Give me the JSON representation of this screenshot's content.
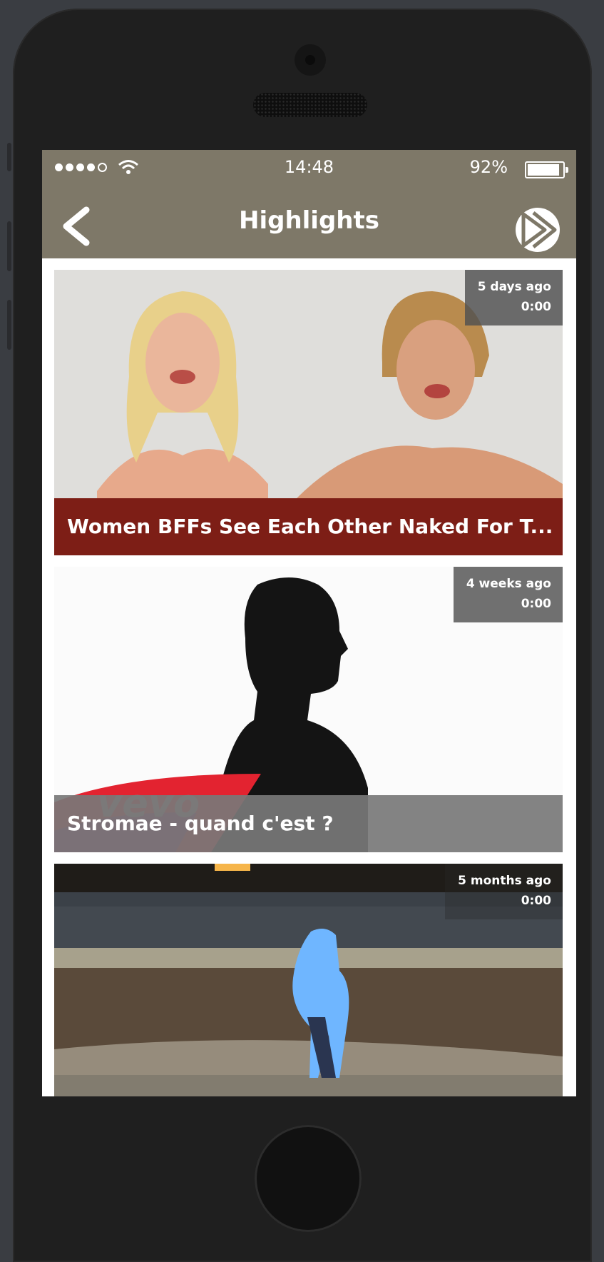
{
  "status_bar": {
    "time": "14:48",
    "battery_percent": "92%"
  },
  "nav": {
    "title": "Highlights",
    "back_icon": "chevron-left-icon",
    "logo_icon": "play-logo-icon"
  },
  "videos": [
    {
      "age": "5 days ago",
      "duration": "0:00",
      "title": "Women BFFs See Each Other Naked For T..."
    },
    {
      "age": "4 weeks ago",
      "duration": "0:00",
      "title": "Stromae - quand c'est ?"
    },
    {
      "age": "5 months ago",
      "duration": "0:00"
    }
  ],
  "colors": {
    "nav_background": "#7e7868",
    "card1_title_bar": "#7d1e16",
    "card2_title_bar": "#7a7a7a"
  }
}
